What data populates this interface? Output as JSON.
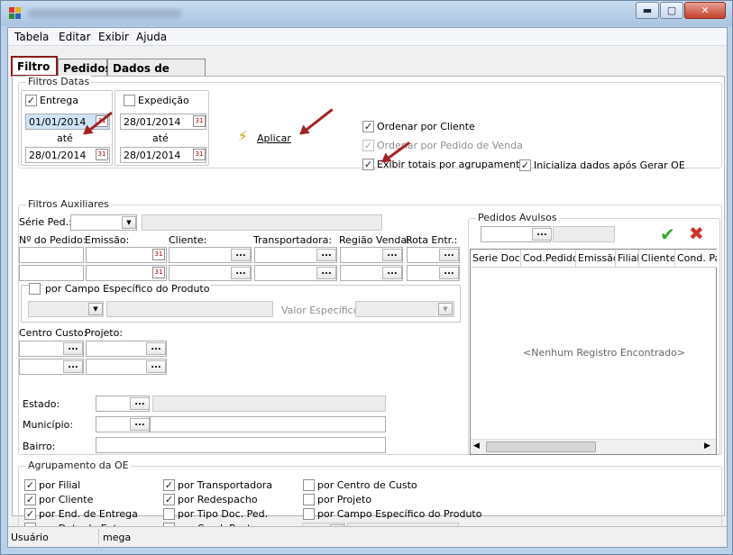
{
  "menu": [
    "Tabela",
    "Editar",
    "Exibir",
    "Ajuda"
  ],
  "tabs": [
    "Filtro",
    "Pedidos",
    "Dados de Entrega"
  ],
  "filtros_datas": {
    "legend": "Filtros Datas",
    "entrega_label": "Entrega",
    "entrega_from": "01/01/2014",
    "entrega_to": "28/01/2014",
    "ate": "até",
    "expedicao_label": "Expedição",
    "expedicao_from": "28/01/2014",
    "expedicao_to": "28/01/2014"
  },
  "aplicar": "Aplicar",
  "options": {
    "ordenar_cliente": "Ordenar por Cliente",
    "ordenar_pedido": "Ordenar por Pedido de Venda",
    "exibir_totais": "Exibir totais por agrupamento",
    "inicializa": "Inicializa dados após Gerar OE"
  },
  "filtros_aux": {
    "legend": "Filtros Auxiliares",
    "serie_ped": "Série Ped.:",
    "cols": [
      "Nº do Pedido:",
      "Emissão:",
      "Cliente:",
      "Transportadora:",
      "Região Venda:",
      "Rota Entr.:"
    ],
    "campo_especifico": "por Campo Específico do Produto",
    "valor_especifico": "Valor Específico",
    "centro_custo": "Centro Custo:",
    "projeto": "Projeto:",
    "estado": "Estado:",
    "municipio": "Município:",
    "bairro": "Bairro:"
  },
  "pedidos_avulsos": {
    "legend": "Pedidos Avulsos",
    "headers": [
      "Serie Doc.",
      "Cod.Pedido",
      "Emissão",
      "Filial",
      "Cliente",
      "Cond. Pag"
    ],
    "empty": "<Nenhum Registro Encontrado>"
  },
  "agrupamento": {
    "legend": "Agrupamento da OE",
    "col1": [
      "por Filial",
      "por Cliente",
      "por End. de Entrega",
      "por Data de Entrega"
    ],
    "col2": [
      "por Transportadora",
      "por Redespacho",
      "por Tipo Doc. Ped.",
      "por Cond. Pagto."
    ],
    "col3": [
      "por Centro de Custo",
      "por Projeto",
      "por Campo Específico do Produto"
    ]
  },
  "status": {
    "label": "Usuário",
    "value": "mega"
  },
  "window_controls": {
    "minimize": "▬",
    "maximize": "▢",
    "close": "✕"
  }
}
